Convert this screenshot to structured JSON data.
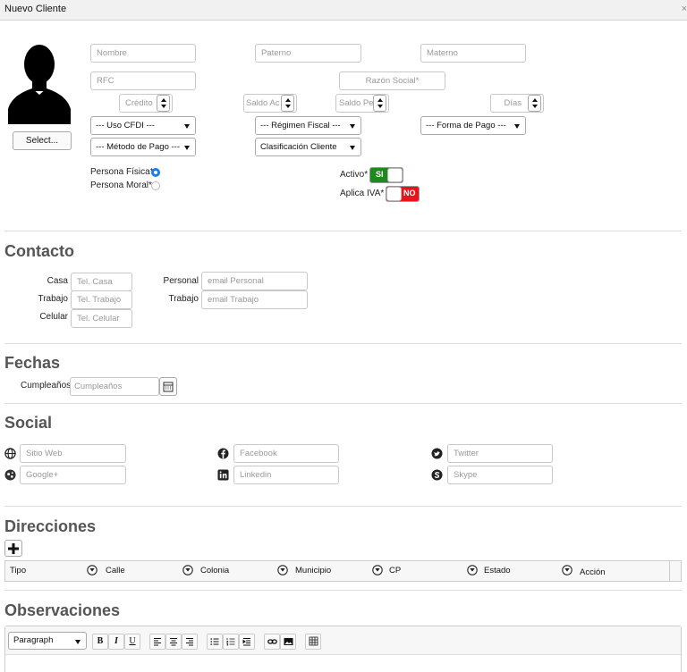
{
  "window": {
    "title": "Nuevo Cliente",
    "close": "×"
  },
  "photo": {
    "select_label": "Select..."
  },
  "form": {
    "nombre_ph": "Nombre",
    "paterno_ph": "Paterno",
    "materno_ph": "Materno",
    "rfc_ph": "RFC",
    "razon_ph": "Razón Social*",
    "credito_ph": "Crédito",
    "saldo_ac_ph": "Saldo Ac",
    "saldo_pe_ph": "Saldo Pe",
    "dias_ph": "Días",
    "uso_cfdi": "--- Uso CFDI ---",
    "regimen": "--- Régimen Fiscal ---",
    "forma_pago": "--- Forma de Pago ---",
    "metodo_pago": "--- Método de Pago ---",
    "clasificacion": "Clasificación Cliente",
    "persona_fisica": "Persona Física*",
    "persona_moral": "Persona Moral*",
    "activo_label": "Activo*",
    "activo_state": "SI",
    "iva_label": "Aplica IVA*",
    "iva_state": "NO",
    "colors": {
      "on": "#1e8a1e",
      "off": "#e8141c",
      "radio": "#1a7ee6"
    }
  },
  "contacto": {
    "title": "Contacto",
    "casa_label": "Casa",
    "casa_ph": "Tel. Casa",
    "trabajo_label": "Trabajo",
    "trabajo_ph": "Tel. Trabajo",
    "celular_label": "Celular",
    "celular_ph": "Tel. Celular",
    "personal_label": "Personal",
    "personal_ph": "email Personal",
    "email_trabajo_label": "Trabajo",
    "email_trabajo_ph": "email Trabajo"
  },
  "fechas": {
    "title": "Fechas",
    "cumple_label": "Cumpleaños",
    "cumple_ph": "Cumpleaños"
  },
  "social": {
    "title": "Social",
    "web_ph": "Sitio Web",
    "google_ph": "Google+",
    "facebook_ph": "Facebook",
    "linkedin_ph": "Linkedin",
    "twitter_ph": "Twitter",
    "skype_ph": "Skype"
  },
  "direcciones": {
    "title": "Direcciones",
    "columns": [
      "Tipo",
      "Calle",
      "Colonia",
      "Municipio",
      "CP",
      "Estado",
      "Acción"
    ]
  },
  "observaciones": {
    "title": "Observaciones",
    "format": "Paragraph",
    "bold": "B",
    "italic": "I",
    "underline": "U"
  }
}
